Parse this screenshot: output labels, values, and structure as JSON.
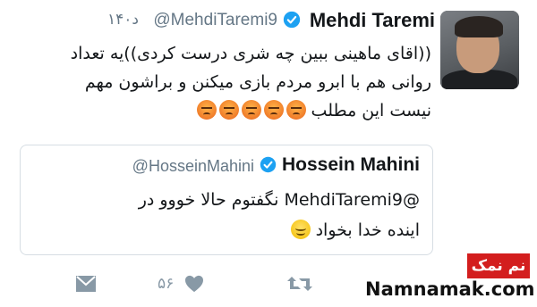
{
  "tweet": {
    "display_name": "Mehdi Taremi",
    "handle": "@MehdiTaremi9",
    "time": "۱۴۰د",
    "text_lines": [
      "((اقای ماهینی ببین چه شری درست کردی))یه تعداد",
      "روانی هم با ابرو مردم بازی میکنن و براشون مهم",
      "نیست این مطلب"
    ],
    "emoji": "angry-face",
    "emoji_count": 5
  },
  "quoted": {
    "display_name": "Hossein Mahini",
    "handle": "@HosseinMahini",
    "text_lines": [
      "@MehdiTaremi9 نگفتوم حالا خووو در",
      "اینده خدا بخواد"
    ],
    "emoji": "smiling-face"
  },
  "actions": {
    "like_count": "۵۶",
    "icons": [
      "direct-message-icon",
      "like-heart-icon",
      "retweet-icon"
    ]
  },
  "watermark": {
    "badge_text": "نم نمک",
    "site_text": "Namnamak.com",
    "badge_color": "#d31e1e"
  },
  "colors": {
    "verified": "#1da1f2",
    "muted": "#657786",
    "icon": "#8899a6"
  }
}
